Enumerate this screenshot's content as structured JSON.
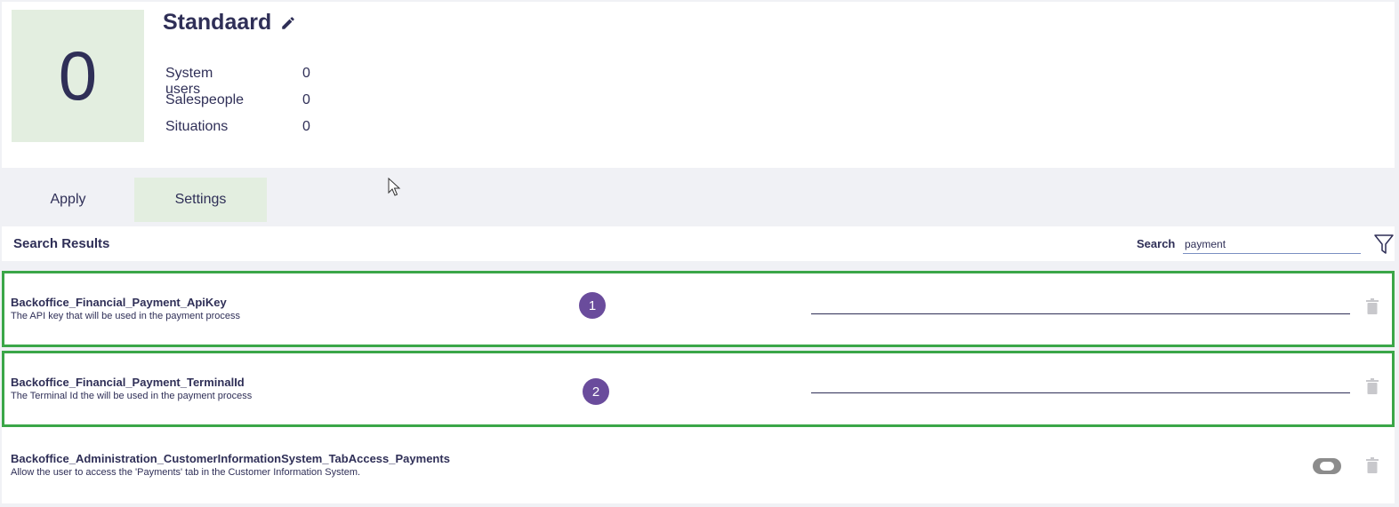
{
  "profile": {
    "count": "0",
    "title": "Standaard",
    "stats": [
      {
        "label": "System users",
        "value": "0"
      },
      {
        "label": "Salespeople",
        "value": "0"
      },
      {
        "label": "Situations",
        "value": "0"
      }
    ]
  },
  "tabs": [
    {
      "label": "Apply",
      "active": false
    },
    {
      "label": "Settings",
      "active": true
    }
  ],
  "results": {
    "title": "Search Results",
    "search_label": "Search",
    "search_value": "payment"
  },
  "rows": [
    {
      "name": "Backoffice_Financial_Payment_ApiKey",
      "description": "The API key that will be used in the payment process",
      "badge": "1",
      "control": "text",
      "value": ""
    },
    {
      "name": "Backoffice_Financial_Payment_TerminalId",
      "description": "The Terminal Id the will be used in the payment process",
      "badge": "2",
      "control": "text",
      "value": ""
    },
    {
      "name": "Backoffice_Administration_CustomerInformationSystem_TabAccess_Payments",
      "description": "Allow the user to access the 'Payments' tab in the Customer Information System.",
      "control": "toggle",
      "enabled": false
    }
  ],
  "icons": {
    "edit": "pencil-icon",
    "filter": "filter-icon",
    "delete": "trash-icon"
  },
  "colors": {
    "text": "#2f2f57",
    "accent_green_bg": "#e3eee0",
    "highlight_border": "#3aa648",
    "badge": "#6a4c9c",
    "page_bg": "#f0f1f5"
  }
}
